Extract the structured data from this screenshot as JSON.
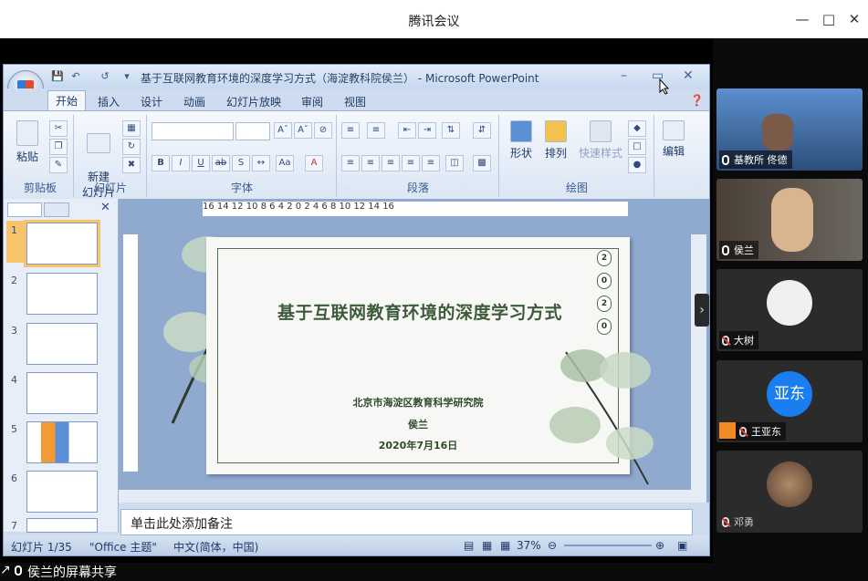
{
  "meeting": {
    "window_title": "腾讯会议",
    "share_label": "侯兰的屏幕共享"
  },
  "ppt": {
    "window_caption": "基于互联网教育环境的深度学习方式（海淀教科院侯兰） - Microsoft PowerPoint",
    "tabs": [
      "开始",
      "插入",
      "设计",
      "动画",
      "幻灯片放映",
      "审阅",
      "视图"
    ],
    "active_tab": "开始",
    "groups": {
      "clipboard": {
        "label": "剪贴板",
        "paste": "粘贴"
      },
      "slides": {
        "label": "幻灯片",
        "new_slide": "新建\n幻灯片"
      },
      "font": {
        "label": "字体"
      },
      "paragraph": {
        "label": "段落"
      },
      "drawing": {
        "label": "绘图",
        "shapes": "形状",
        "arrange": "排列",
        "quick_styles": "快速样式"
      },
      "editing": {
        "label": "编辑"
      }
    },
    "ruler_text": "16 14 12 10 8 6 4 2 0 2 4 6 8 10 12 14 16",
    "thumbnail_numbers": [
      "1",
      "2",
      "3",
      "4",
      "5",
      "6",
      "7"
    ],
    "slide": {
      "title": "基于互联网教育环境的深度学习方式",
      "institution": "北京市海淀区教育科学研究院",
      "author": "侯兰",
      "date": "2020年7月16日",
      "side_digits": [
        "2",
        "0",
        "2",
        "0"
      ]
    },
    "notes_placeholder": "单击此处添加备注",
    "status": {
      "slide_counter": "幻灯片 1/35",
      "theme": "\"Office 主题\"",
      "language": "中文(简体，中国)",
      "zoom": "37%"
    }
  },
  "participants": [
    {
      "name": "基教所 佟德",
      "mic": "on"
    },
    {
      "name": "侯兰",
      "mic": "on"
    },
    {
      "name": "大树",
      "mic": "off"
    },
    {
      "name": "王亚东",
      "mic": "off",
      "avatar_text": "亚东"
    },
    {
      "name": "邓勇",
      "mic": "off"
    }
  ],
  "colors": {
    "avatar_blue": "#1a7ef0",
    "ribbon_bg": "#dbe6f4",
    "slide_text": "#3d5a3a"
  }
}
